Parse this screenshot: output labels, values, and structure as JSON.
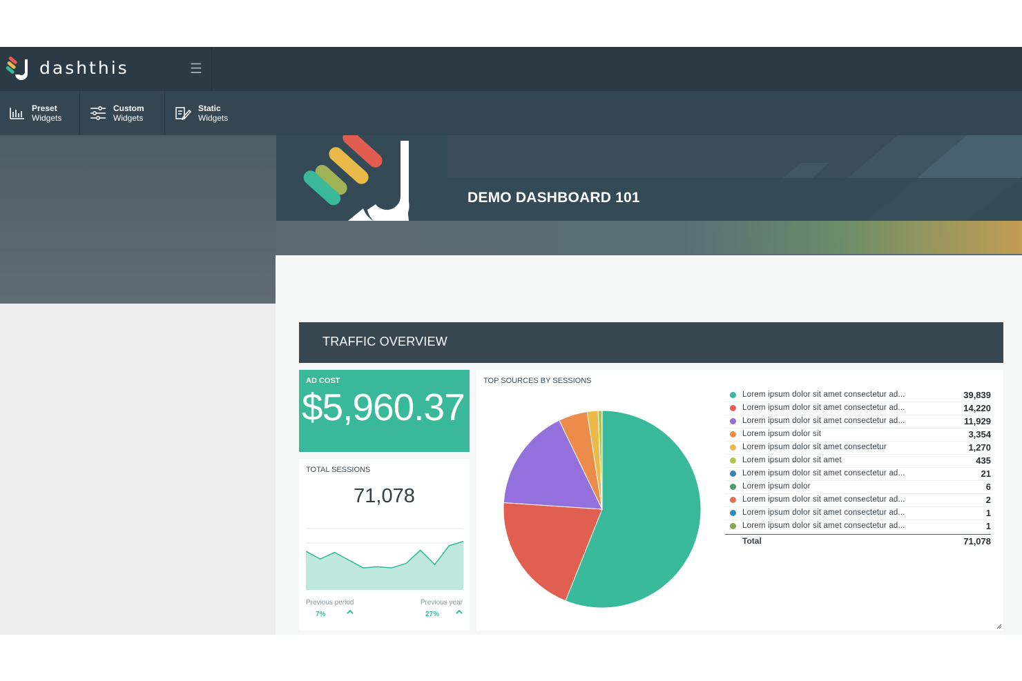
{
  "brand": {
    "name": "dashthis",
    "menu_icon": "hamburger-icon"
  },
  "widget_bar": [
    {
      "title": "Preset",
      "subtitle": "Widgets",
      "icon": "bar-chart-icon"
    },
    {
      "title": "Custom",
      "subtitle": "Widgets",
      "icon": "sliders-icon"
    },
    {
      "title": "Static",
      "subtitle": "Widgets",
      "icon": "edit-note-icon"
    }
  ],
  "dashboard": {
    "title": "DEMO DASHBOARD 101"
  },
  "section": {
    "title": "TRAFFIC OVERVIEW"
  },
  "ad_cost": {
    "label": "AD COST",
    "value": "$5,960.37"
  },
  "total_sessions": {
    "label": "TOTAL SESSIONS",
    "value": "71,078",
    "previous_period_label": "Previous period",
    "previous_period_value": "7%",
    "previous_year_label": "Previous year",
    "previous_year_value": "27%",
    "trend_icon": "chevron-up-icon"
  },
  "colors": {
    "accent": "#3ab99a",
    "topbar": "#2b3a44",
    "section": "#374852"
  },
  "chart_data": [
    {
      "type": "area",
      "series": [
        {
          "values": [
            55,
            48,
            54,
            47,
            40,
            41,
            40,
            44,
            56,
            43,
            60,
            64
          ]
        }
      ],
      "ylim": [
        20,
        75
      ]
    },
    {
      "type": "pie",
      "title": "TOP SOURCES BY SESSIONS",
      "categories": [
        "Lorem ipsum dolor sit amet consectetur ad...",
        "Lorem ipsum dolor sit amet consectetur ad...",
        "Lorem ipsum dolor sit amet consectetur ad...",
        "Lorem ipsum dolor sit",
        "Lorem ipsum dolor sit amet consectetur",
        "Lorem ipsum dolor sit amet",
        "Lorem ipsum dolor sit amet consectetur ad...",
        "Lorem ipsum dolor",
        "Lorem ipsum dolor sit amet consectetur ad...",
        "Lorem ipsum dolor sit amet consectetur ad...",
        "Lorem ipsum dolor sit amet consectetur ad..."
      ],
      "values": [
        39839,
        14220,
        11929,
        3354,
        1270,
        435,
        21,
        6,
        2,
        1,
        1
      ],
      "value_labels": [
        "39,839",
        "14,220",
        "11,929",
        "3,354",
        "1,270",
        "435",
        "21",
        "6",
        "2",
        "1",
        "1"
      ],
      "colors": [
        "#38b99a",
        "#e15f50",
        "#9370db",
        "#ec8c4b",
        "#e9b949",
        "#b3c44c",
        "#3284bf",
        "#4c9a6a",
        "#e0704f",
        "#2b8fb6",
        "#86a752"
      ],
      "total_label": "Total",
      "total_value": "71,078",
      "legend": "right"
    }
  ]
}
